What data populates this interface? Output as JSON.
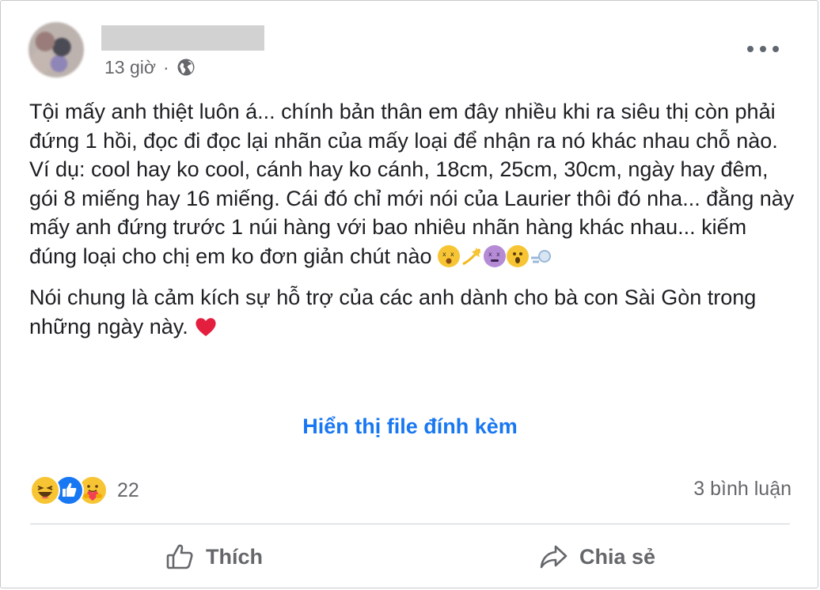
{
  "post": {
    "time": "13 giờ",
    "separator": "·",
    "paragraph1": "Tội mấy anh thiệt luôn á... chính bản thân em đây nhiều khi ra siêu thị còn phải đứng 1 hồi, đọc đi đọc lại nhãn của mấy loại để nhận ra nó khác nhau chỗ nào. Ví dụ: cool hay ko cool, cánh hay ko cánh, 18cm, 25cm, 30cm, ngày hay đêm, gói 8 miếng hay 16 miếng. Cái đó chỉ mới nói của Laurier thôi đó nha... đằng này mấy anh đứng trước 1 núi hàng với bao nhiêu nhãn hàng khác nhau... kiếm đúng loại cho chị em ko đơn giản chút nào ",
    "paragraph2": "Nói chung là cảm kích sự hỗ trợ của các anh dành cho bà con Sài Gòn trong những ngày này. ",
    "show_attachment": "Hiển thị file đính kèm"
  },
  "icons": {
    "privacy": "globe-icon",
    "menu": "more-options-icon",
    "paragraph1_emojis": [
      "dizzy-face-emoji",
      "dizzy-emoji",
      "knocked-out-face-emoji",
      "hushed-face-emoji",
      "dash-emoji"
    ],
    "paragraph2_emojis": [
      "red-heart-emoji"
    ],
    "reactions": [
      "haha-reaction-icon",
      "like-reaction-icon",
      "care-reaction-icon"
    ]
  },
  "stats": {
    "reaction_count": "22",
    "comment_count": "3 bình luận"
  },
  "actions": {
    "like": "Thích",
    "share": "Chia sẻ"
  },
  "colors": {
    "link": "#1877f2",
    "secondary_text": "#65676b",
    "heart": "#e41e3f"
  }
}
